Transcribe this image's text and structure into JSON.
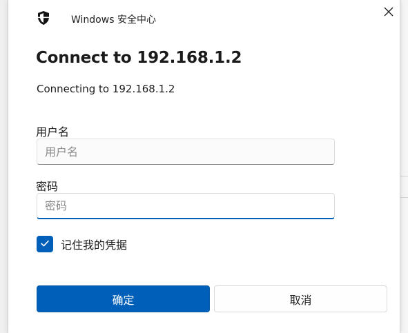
{
  "window": {
    "title": "Windows 安全中心",
    "icon": "shield-icon",
    "close_icon": "close-icon"
  },
  "dialog": {
    "heading": "Connect to 192.168.1.2",
    "subtext": "Connecting to 192.168.1.2"
  },
  "fields": {
    "username": {
      "label": "用户名",
      "placeholder": "用户名",
      "value": ""
    },
    "password": {
      "label": "密码",
      "placeholder": "密码",
      "value": ""
    }
  },
  "remember": {
    "label": "记住我的凭据",
    "checked": true,
    "icon": "checkmark-icon"
  },
  "buttons": {
    "ok": "确定",
    "cancel": "取消"
  },
  "colors": {
    "accent": "#005fb8"
  }
}
